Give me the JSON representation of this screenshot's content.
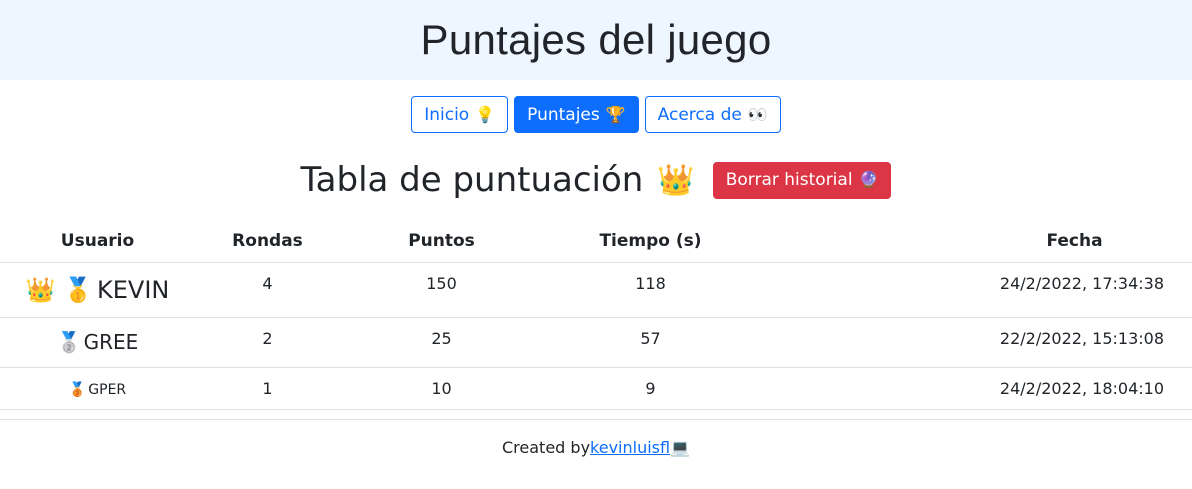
{
  "header": {
    "title": "Puntajes del juego"
  },
  "nav": [
    {
      "label": "Inicio",
      "emoji": "💡"
    },
    {
      "label": "Puntajes",
      "emoji": "🏆"
    },
    {
      "label": "Acerca de",
      "emoji": "👀"
    }
  ],
  "scoreboard": {
    "title": "Tabla de puntuación",
    "title_emoji": "👑",
    "clear_button": {
      "label": "Borrar historial",
      "emoji": "🔮"
    }
  },
  "table": {
    "columns": [
      "Usuario",
      "Rondas",
      "Puntos",
      "Tiempo (s)",
      "Fecha"
    ],
    "rows": [
      {
        "badges": "👑 🥇",
        "user": "KEVIN",
        "rondas": "4",
        "puntos": "150",
        "tiempo": "118",
        "fecha": "24/2/2022, 17:34:38"
      },
      {
        "badges": "🥈",
        "user": "GREE",
        "rondas": "2",
        "puntos": "25",
        "tiempo": "57",
        "fecha": "22/2/2022, 15:13:08"
      },
      {
        "badges": "🥉",
        "user": "GPER",
        "rondas": "1",
        "puntos": "10",
        "tiempo": "9",
        "fecha": "24/2/2022, 18:04:10"
      }
    ]
  },
  "footer": {
    "prefix": "Created by",
    "link": "kevinluisfl",
    "emoji": "💻"
  }
}
